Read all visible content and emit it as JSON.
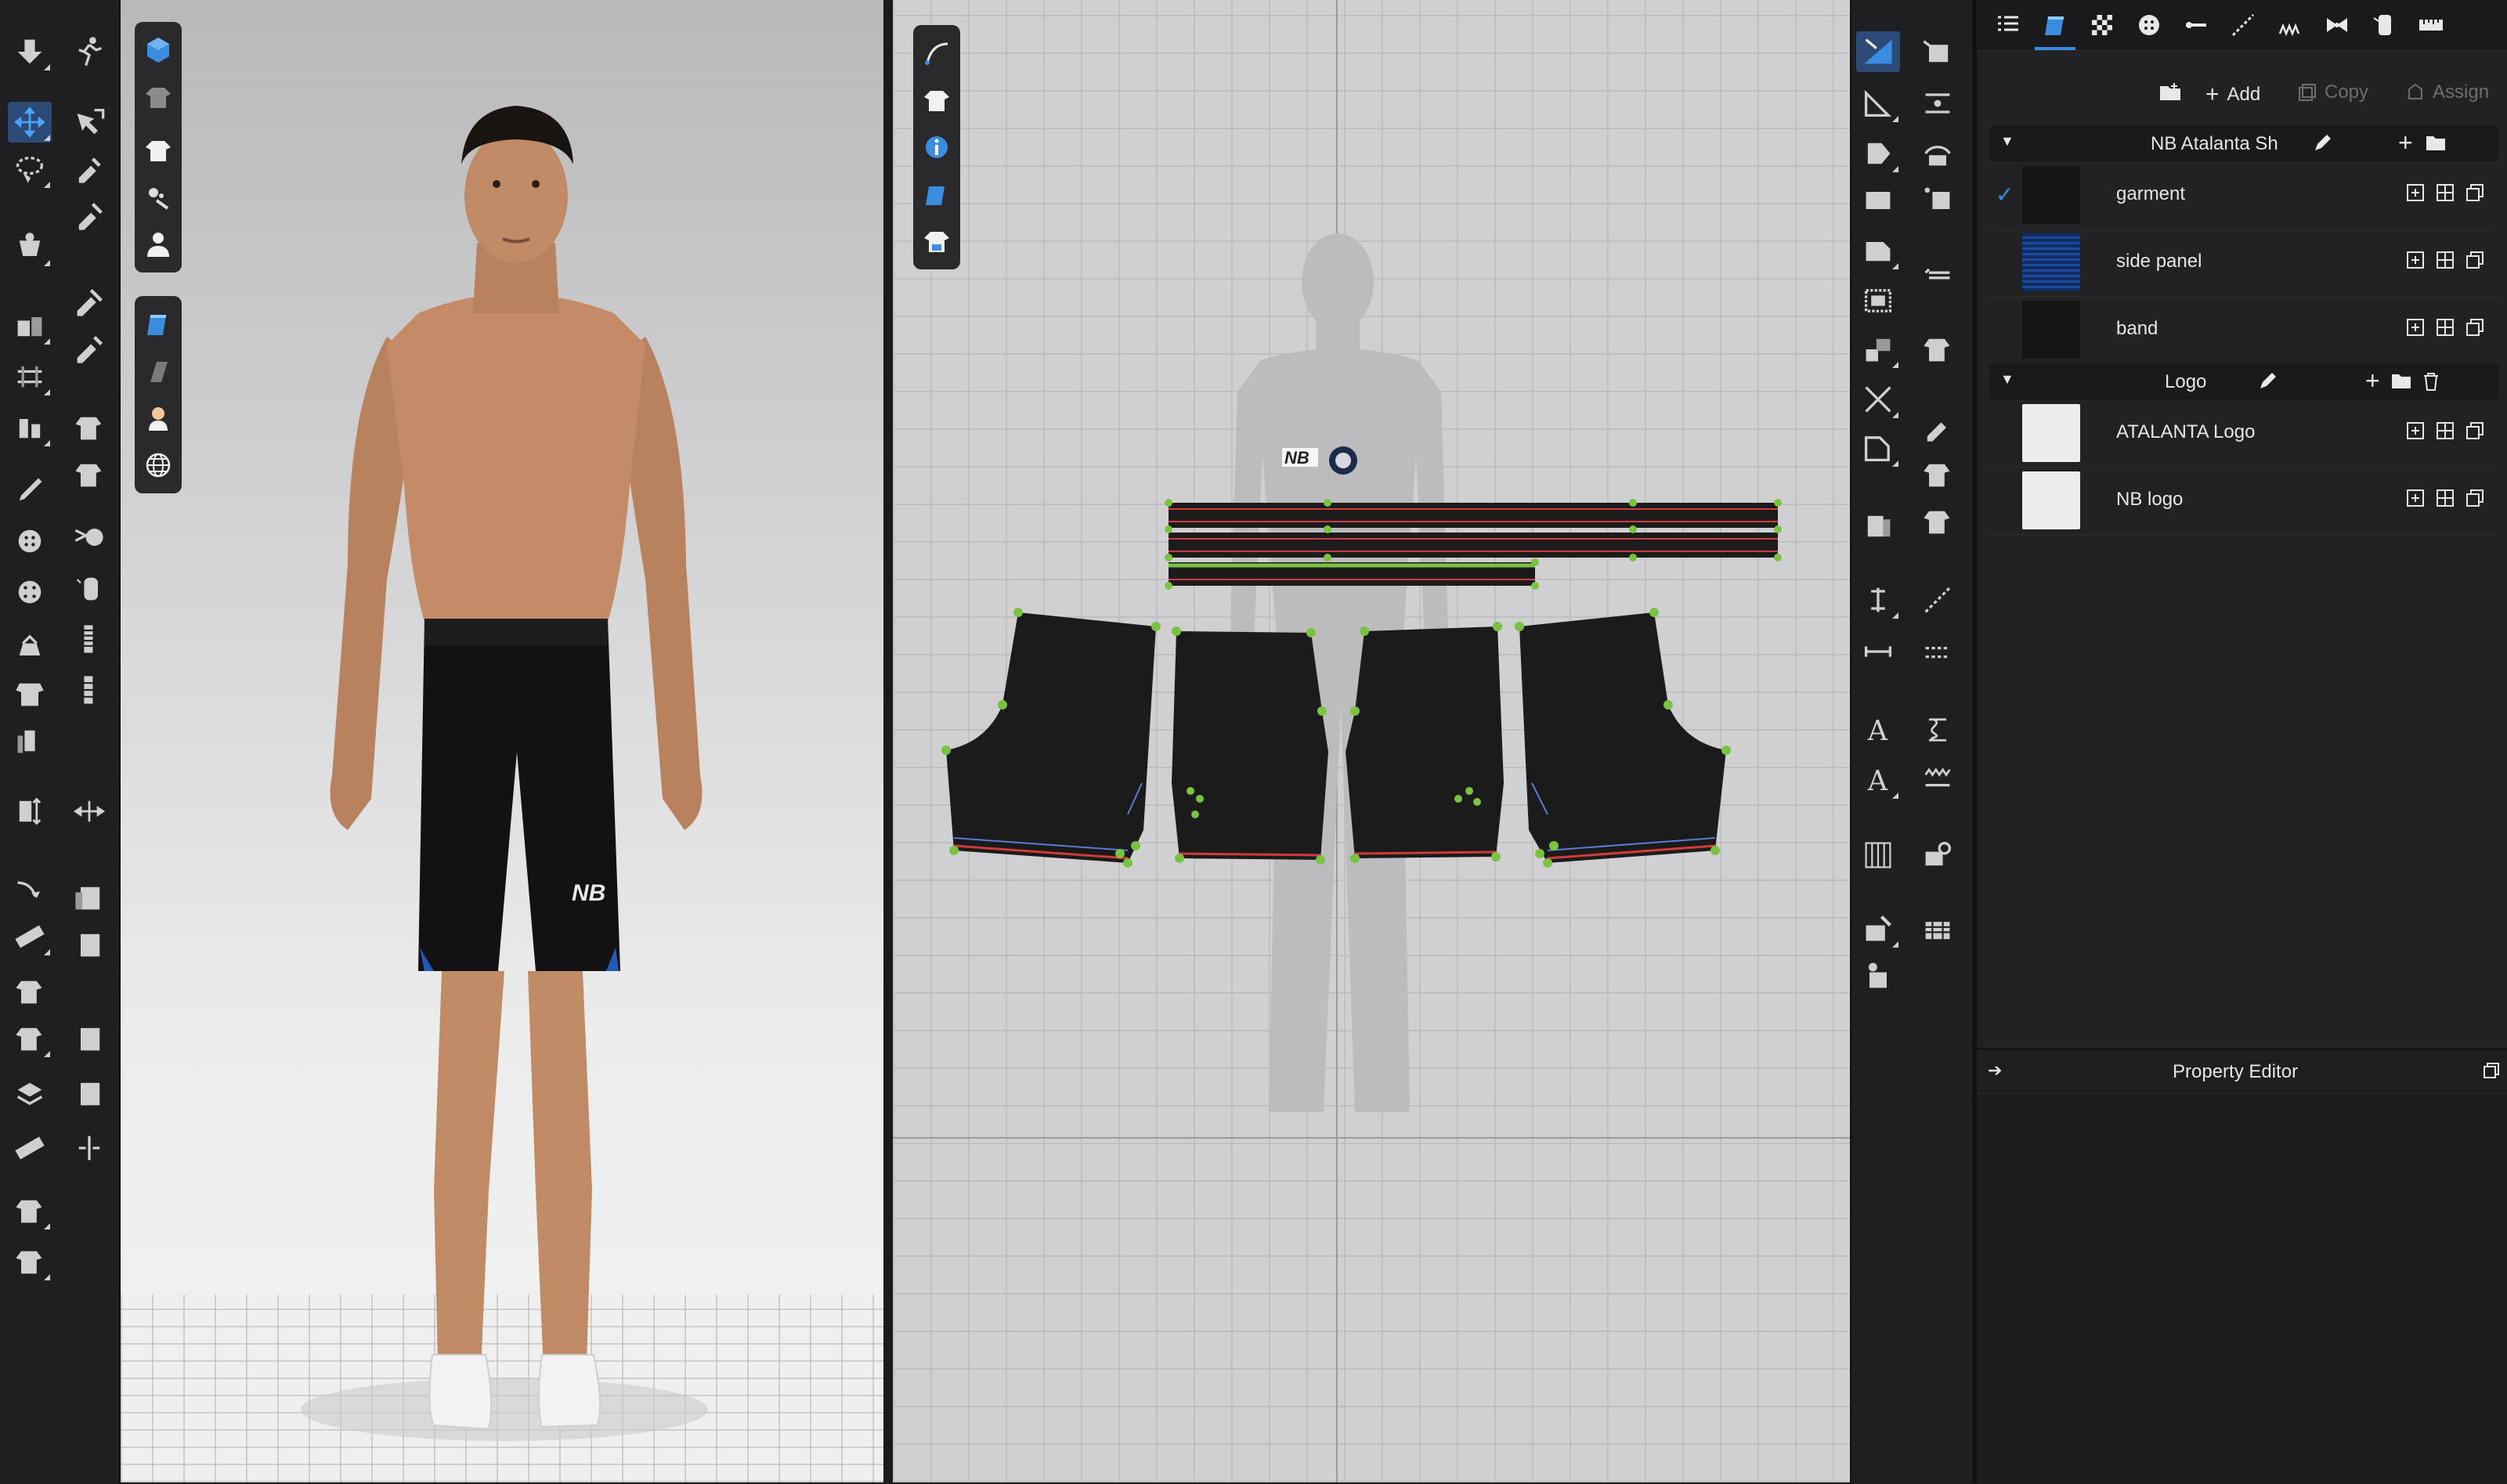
{
  "left_tools": [
    {
      "icon": "drop-down-arrow-icon"
    },
    {
      "icon": "run-avatar-icon"
    },
    {
      "icon": "transform-move-icon",
      "active": true
    },
    {
      "icon": "select-mesh-icon"
    },
    {
      "icon": "lasso-select-icon"
    },
    {
      "icon": "edit-pattern-icon"
    },
    {
      "icon": "pin-tool-icon"
    },
    {
      "icon": "fold-arrangement-icon"
    },
    {
      "icon": "tack-icon"
    },
    {
      "icon": "sewing-icon"
    },
    {
      "icon": "steam-icon"
    },
    {
      "icon": "measure-icon"
    },
    {
      "icon": "topstitch-icon"
    },
    {
      "icon": "garment-tuck-icon"
    },
    {
      "icon": "pen-icon"
    },
    {
      "icon": "sewing-3d-icon"
    },
    {
      "icon": "button-tool-icon"
    },
    {
      "icon": "buttonhole-icon"
    },
    {
      "icon": "zipper-icon"
    },
    {
      "icon": "trim-icon"
    },
    {
      "icon": "garment-fit-icon"
    },
    {
      "icon": "pleat-icon"
    },
    {
      "icon": "fabric-icon"
    },
    {
      "icon": "size-icon"
    },
    {
      "icon": "elastic-icon"
    },
    {
      "icon": "tape-measure-icon"
    },
    {
      "icon": "shrink-icon"
    }
  ],
  "viewport3d_tools_top": [
    {
      "icon": "cube-icon"
    },
    {
      "icon": "shirt-outline-icon"
    },
    {
      "icon": "shirt-icon"
    },
    {
      "icon": "sewing-lines-icon"
    },
    {
      "icon": "avatar-icon"
    }
  ],
  "viewport3d_tools_bottom": [
    {
      "icon": "fabric-blue-icon"
    },
    {
      "icon": "texture-icon"
    },
    {
      "icon": "skin-icon"
    },
    {
      "icon": "globe-icon"
    }
  ],
  "viewport2d_tools": [
    {
      "icon": "pen-curve-icon"
    },
    {
      "icon": "shirt-icon"
    },
    {
      "icon": "info-icon"
    },
    {
      "icon": "fabric-blue-icon"
    },
    {
      "icon": "shirt-3d-icon"
    }
  ],
  "right_tools": [
    {
      "icon": "edit-pattern-2d-icon",
      "active": true
    },
    {
      "icon": "segment-icon"
    },
    {
      "icon": "transform-2d-icon"
    },
    {
      "icon": "curve-point-icon"
    },
    {
      "icon": "polygon-icon"
    },
    {
      "icon": "rectangle-icon"
    },
    {
      "icon": "internal-polygon-icon"
    },
    {
      "icon": "dart-icon"
    },
    {
      "icon": "trace-icon"
    },
    {
      "icon": "flatten-icon"
    },
    {
      "icon": "seam-allowance-icon"
    },
    {
      "icon": "notch-icon"
    },
    {
      "icon": "measure-2d-icon"
    },
    {
      "icon": "grain-icon"
    },
    {
      "icon": "text-icon"
    },
    {
      "icon": "annotation-icon"
    },
    {
      "icon": "text-2d-icon"
    },
    {
      "icon": "elastic-2d-icon"
    },
    {
      "icon": "grid-icon"
    },
    {
      "icon": "fabric-brush-icon"
    },
    {
      "icon": "pin-2d-icon"
    },
    {
      "icon": "button-2d-icon"
    }
  ],
  "panel": {
    "tabs": [
      {
        "icon": "list-icon"
      },
      {
        "icon": "fabric-icon",
        "active": true
      },
      {
        "icon": "checker-icon"
      },
      {
        "icon": "button-icon"
      },
      {
        "icon": "buttonhole-icon"
      },
      {
        "icon": "topstitch-icon"
      },
      {
        "icon": "puckering-icon"
      },
      {
        "icon": "bow-icon"
      },
      {
        "icon": "zipper-icon"
      },
      {
        "icon": "ruler-icon"
      }
    ],
    "actions": {
      "add": "Add",
      "copy": "Copy",
      "assign": "Assign"
    },
    "groups": [
      {
        "name": "NB Atalanta Sh",
        "items": [
          {
            "label": "garment",
            "checked": true,
            "swatch": "#151515"
          },
          {
            "label": "side panel",
            "checked": false,
            "swatch": "#10306a"
          },
          {
            "label": "band",
            "checked": false,
            "swatch": "#141414"
          }
        ]
      },
      {
        "name": "Logo",
        "items": [
          {
            "label": "ATALANTA Logo",
            "checked": false,
            "swatch": "#ececec"
          },
          {
            "label": "NB logo",
            "checked": false,
            "swatch": "#ececec"
          }
        ]
      }
    ],
    "property_editor": "Property Editor"
  },
  "colors": {
    "accent": "#3a8dde",
    "panel_bg": "#222224",
    "pattern_black": "#1b1b1b",
    "point_green": "#7cc242",
    "line_red": "#d23b3b"
  }
}
